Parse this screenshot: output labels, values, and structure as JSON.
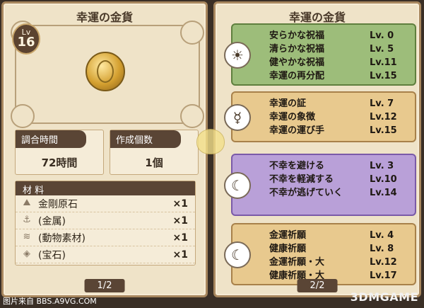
{
  "left": {
    "title": "幸運の金貨",
    "level_label": "Lv",
    "level_value": "16",
    "stats": [
      {
        "label": "調合時間",
        "value": "72時間"
      },
      {
        "label": "作成個数",
        "value": "1個"
      }
    ],
    "materials_label": "材 料",
    "materials": [
      {
        "name": "金剛原石",
        "qty": "×1"
      },
      {
        "name": "(金属)",
        "qty": "×1"
      },
      {
        "name": "(動物素材)",
        "qty": "×1"
      },
      {
        "name": "(宝石)",
        "qty": "×1"
      }
    ],
    "page": "1/2"
  },
  "right": {
    "title": "幸運の金貨",
    "groups": [
      {
        "icon": "☀",
        "skills": [
          {
            "name": "安らかな祝福",
            "level": "Lv. 0"
          },
          {
            "name": "清らかな祝福",
            "level": "Lv. 5"
          },
          {
            "name": "健やかな祝福",
            "level": "Lv.11"
          },
          {
            "name": "幸運の再分配",
            "level": "Lv.15"
          }
        ]
      },
      {
        "icon": "☿",
        "skills": [
          {
            "name": "幸運の証",
            "level": "Lv. 7"
          },
          {
            "name": "幸運の象徴",
            "level": "Lv.12"
          },
          {
            "name": "幸運の運び手",
            "level": "Lv.15"
          }
        ]
      },
      {
        "icon": "☾",
        "skills": [
          {
            "name": "不幸を避ける",
            "level": "Lv. 3"
          },
          {
            "name": "不幸を軽減する",
            "level": "Lv.10"
          },
          {
            "name": "不幸が逃げていく",
            "level": "Lv.14"
          }
        ]
      },
      {
        "icon": "☾",
        "skills": [
          {
            "name": "金運祈願",
            "level": "Lv. 4"
          },
          {
            "name": "健康祈願",
            "level": "Lv. 8"
          },
          {
            "name": "金運祈願・大",
            "level": "Lv.12"
          },
          {
            "name": "健康祈願・大",
            "level": "Lv.17"
          }
        ]
      }
    ],
    "page": "2/2"
  },
  "watermark_left": "图片来自 BBS.A9VG.COM",
  "watermark_right": "3DMGAME"
}
